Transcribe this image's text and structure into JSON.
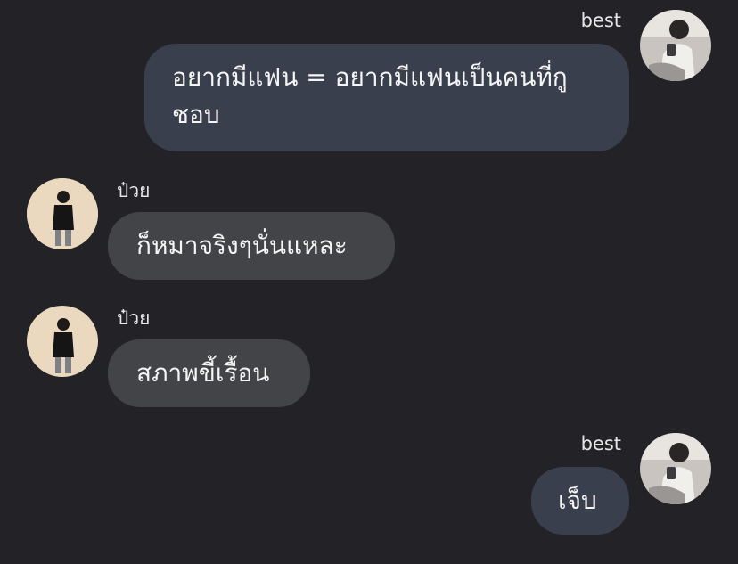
{
  "messages": [
    {
      "sender": "best",
      "text": "อยากมีแฟน = อยากมีแฟนเป็นคนที่กูชอบ",
      "direction": "outgoing"
    },
    {
      "sender": "ป๋วย",
      "text": "ก็หมาจริงๆนั่นแหละ",
      "direction": "incoming"
    },
    {
      "sender": "ป๋วย",
      "text": "สภาพขี้เรื้อน",
      "direction": "incoming"
    },
    {
      "sender": "best",
      "text": "เจ็บ",
      "direction": "outgoing"
    }
  ],
  "colors": {
    "background": "#232327",
    "outgoing_bubble": "#3a3f4e",
    "incoming_bubble": "#434447",
    "text": "#f5f5f5"
  }
}
